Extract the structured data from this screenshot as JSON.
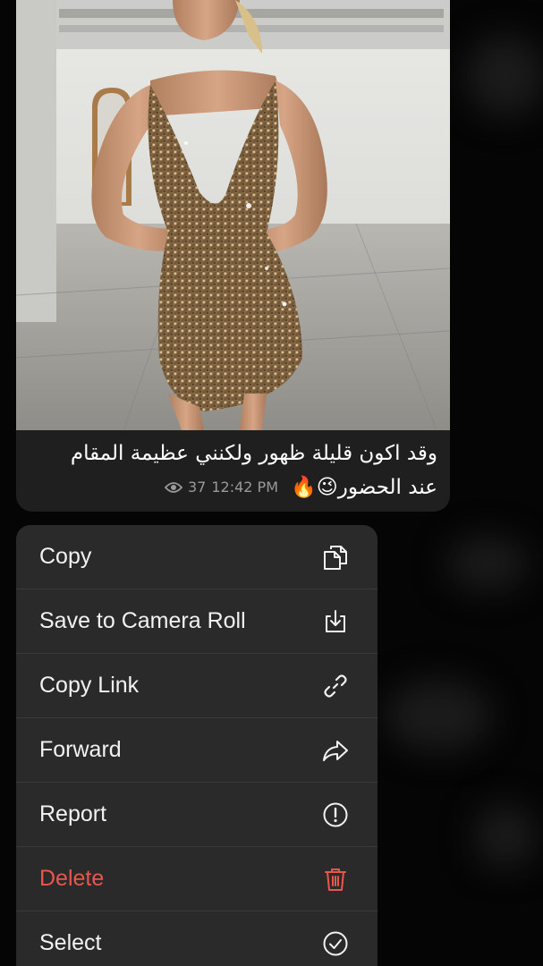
{
  "message": {
    "caption_line1": "وقد اكون قليلة ظهور ولكنني عظيمة المقام",
    "caption_line2": "عند الحضور😉🔥",
    "views": "37",
    "time": "12:42 PM",
    "icons": {
      "views": "eye-icon"
    }
  },
  "menu": {
    "items": [
      {
        "label": "Copy",
        "icon": "copy-icon"
      },
      {
        "label": "Save to Camera Roll",
        "icon": "save-download-icon"
      },
      {
        "label": "Copy Link",
        "icon": "link-icon"
      },
      {
        "label": "Forward",
        "icon": "forward-arrow-icon"
      },
      {
        "label": "Report",
        "icon": "report-exclamation-icon"
      },
      {
        "label": "Delete",
        "icon": "trash-icon",
        "color": "#e9564b"
      },
      {
        "label": "Select",
        "icon": "check-circle-icon"
      }
    ]
  },
  "colors": {
    "menu_bg": "#2a2a2a",
    "danger": "#e9564b",
    "bubble_bg": "#1f1f1f"
  }
}
